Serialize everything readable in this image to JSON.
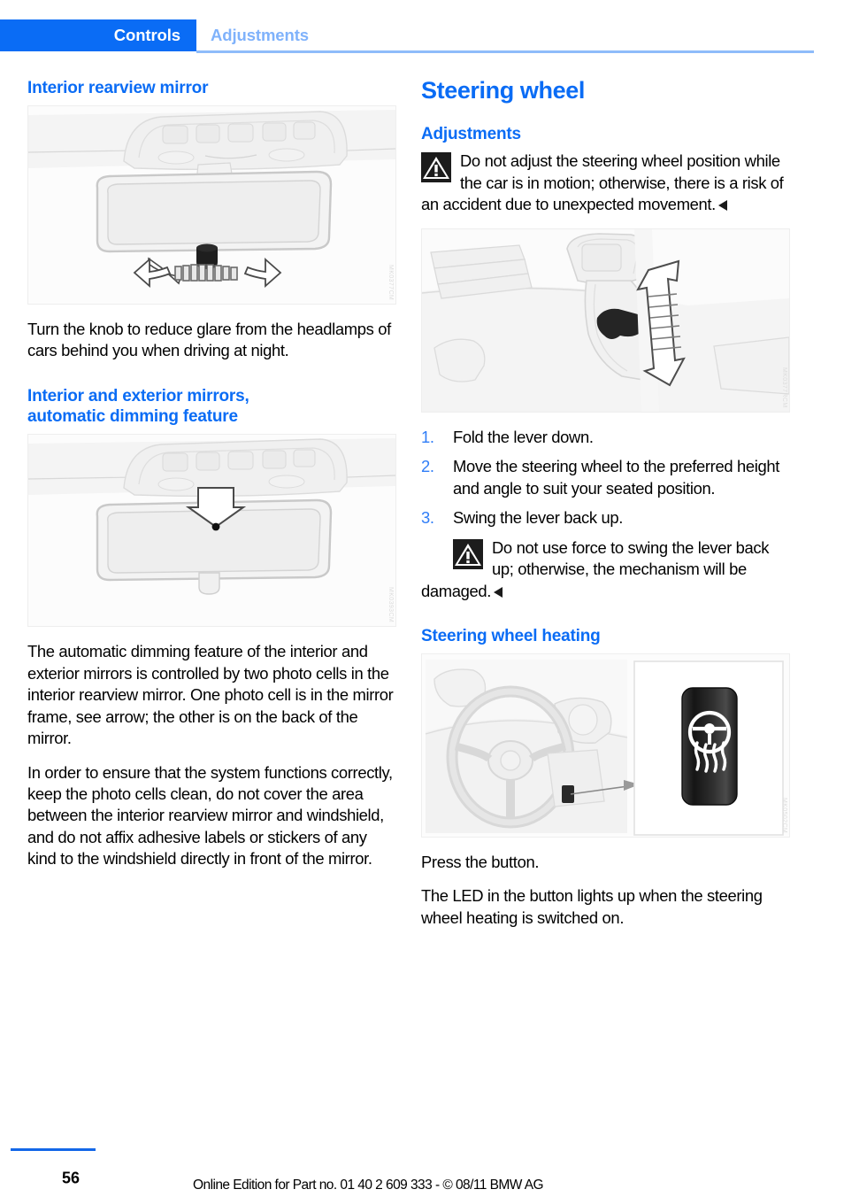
{
  "header": {
    "active_tab": "Controls",
    "inactive_tab": "Adjustments",
    "active_color": "#0a6cf5",
    "inactive_color": "#7fb2fb"
  },
  "left_column": {
    "heading_1": "Interior rearview mirror",
    "figure_1": {
      "name": "interior-rearview-mirror-knob",
      "code": "MK0377CM"
    },
    "paragraph_1": "Turn the knob to reduce glare from the headlamps of cars behind you when driving at night.",
    "heading_2": "Interior and exterior mirrors,\nautomatic dimming feature",
    "heading_2_line1": "Interior and exterior mirrors,",
    "heading_2_line2": "automatic dimming feature",
    "figure_2": {
      "name": "mirror-photo-cell-arrow",
      "code": "MK0393CM"
    },
    "paragraph_2": "The automatic dimming feature of the interior and exterior mirrors is controlled by two photo cells in the interior rearview mirror. One photo cell is in the mirror frame, see arrow; the other is on the back of the mirror.",
    "paragraph_3": "In order to ensure that the system functions correctly, keep the photo cells clean, do not cover the area between the interior rearview mirror and windshield, and do not affix adhesive labels or stickers of any kind to the windshield directly in front of the mirror."
  },
  "right_column": {
    "heading_1": "Steering wheel",
    "heading_2": "Adjustments",
    "warning_1": "Do not adjust the steering wheel position while the car is in motion; otherwise, there is a risk of an accident due to unexpected movement.",
    "figure_1": {
      "name": "steering-column-lever",
      "code": "MK0377RCM"
    },
    "steps": [
      {
        "num": "1.",
        "text": "Fold the lever down."
      },
      {
        "num": "2.",
        "text": "Move the steering wheel to the preferred height and angle to suit your seated position."
      },
      {
        "num": "3.",
        "text": "Swing the lever back up."
      }
    ],
    "warning_2": "Do not use force to swing the lever back up; otherwise, the mechanism will be damaged.",
    "heading_3": "Steering wheel heating",
    "figure_2": {
      "name": "steering-wheel-heating-button",
      "code": "MK0502CM"
    },
    "paragraph_1": "Press the button.",
    "paragraph_2": "The LED in the button lights up when the steering wheel heating is switched on."
  },
  "footer": {
    "page_number": "56",
    "edition_text": "Online Edition for Part no. 01 40 2 609 333 - © 08/11 BMW AG"
  }
}
